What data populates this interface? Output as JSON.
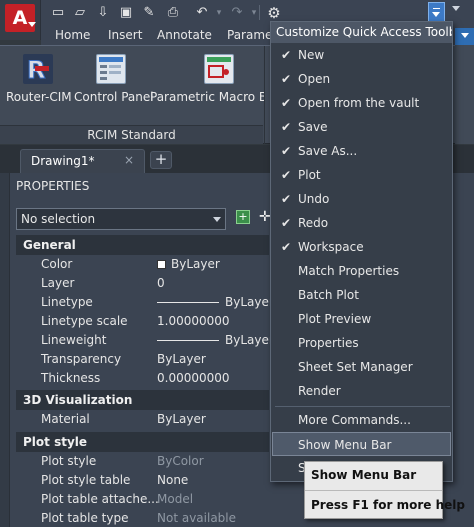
{
  "quick_access": {
    "icons": [
      "new-icon",
      "open-icon",
      "open-from-vault-icon",
      "save-icon",
      "save-as-icon",
      "plot-icon",
      "undo-icon",
      "redo-icon",
      "workspace-gear-icon"
    ]
  },
  "ribbon": {
    "tabs": [
      "Home",
      "Insert",
      "Annotate",
      "Paramet"
    ],
    "buttons": [
      {
        "label": "Router-CIM",
        "icon": "router-cim-icon"
      },
      {
        "label": "Control Panel",
        "icon": "control-panel-icon"
      },
      {
        "label": "Parametric Macro Buil",
        "icon": "parametric-macro-icon"
      }
    ],
    "panel_title": "RCIM Standard"
  },
  "document": {
    "tab_label": "Drawing1*",
    "close_glyph": "×",
    "add_glyph": "+"
  },
  "properties": {
    "title": "PROPERTIES",
    "selection": "No selection",
    "sections": {
      "general": "General",
      "viz3d": "3D Visualization",
      "plot_style": "Plot style"
    },
    "general_rows": [
      {
        "key": "Color",
        "value": "ByLayer"
      },
      {
        "key": "Layer",
        "value": "0"
      },
      {
        "key": "Linetype",
        "value": "ByLayer"
      },
      {
        "key": "Linetype scale",
        "value": "1.00000000"
      },
      {
        "key": "Lineweight",
        "value": "ByLayer"
      },
      {
        "key": "Transparency",
        "value": "ByLayer"
      },
      {
        "key": "Thickness",
        "value": "0.00000000"
      }
    ],
    "viz_rows": [
      {
        "key": "Material",
        "value": "ByLayer"
      }
    ],
    "plot_rows": [
      {
        "key": "Plot style",
        "value": "ByColor"
      },
      {
        "key": "Plot style table",
        "value": "None"
      },
      {
        "key": "Plot table attache...",
        "value": "Model"
      },
      {
        "key": "Plot table type",
        "value": "Not available"
      }
    ]
  },
  "menu": {
    "title": "Customize Quick Access Toolbar",
    "checked_items": [
      "New",
      "Open",
      "Open from the vault",
      "Save",
      "Save As...",
      "Plot",
      "Undo",
      "Redo",
      "Workspace"
    ],
    "unchecked_items": [
      "Match Properties",
      "Batch Plot",
      "Plot Preview",
      "Properties",
      "Sheet Set Manager",
      "Render"
    ],
    "more": "More Commands...",
    "show_menu_bar": "Show Menu Bar",
    "partial_below": "S",
    "check_glyph": "✔"
  },
  "tooltip": {
    "title": "Show Menu Bar",
    "help": "Press F1 for more help"
  },
  "colors": {
    "accent_blue": "#3d7ac6",
    "app_red": "#c42127",
    "menu_bg": "#363e49",
    "highlight": "#4f5a6a"
  }
}
